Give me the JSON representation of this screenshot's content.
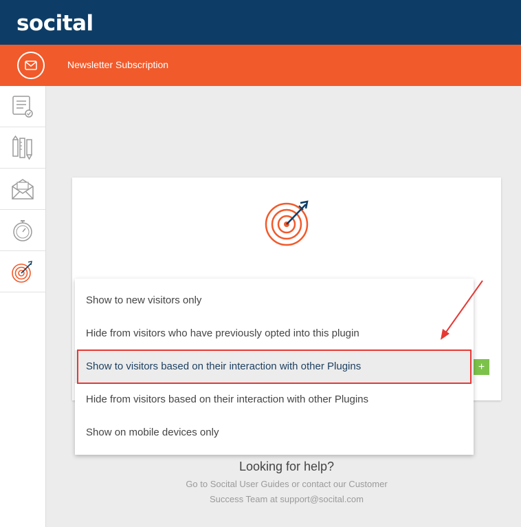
{
  "brand": {
    "logo_text": "socital"
  },
  "header": {
    "title": "Newsletter Subscription",
    "icon": "mail-icon"
  },
  "sidebar": {
    "items": [
      {
        "name": "form-icon"
      },
      {
        "name": "design-tools-icon"
      },
      {
        "name": "envelope-icon"
      },
      {
        "name": "timer-icon"
      },
      {
        "name": "target-icon",
        "active": true
      }
    ]
  },
  "card": {
    "icon": "target-icon",
    "add_label": "+"
  },
  "dropdown": {
    "options": [
      "Show to new visitors only",
      "Hide from visitors who have previously opted into this plugin",
      "Show to visitors based on their interaction with other Plugins",
      "Hide from visitors based on their interaction with other Plugins",
      "Show on mobile devices only"
    ],
    "selected_index": 2
  },
  "help": {
    "title": "Looking for help?",
    "line1": "Go to Socital User Guides or contact our Customer",
    "line2": "Success Team at support@socital.com"
  },
  "colors": {
    "navy": "#0d3d66",
    "orange": "#f15a2b",
    "green": "#7cc24a",
    "annotation_red": "#e53935"
  }
}
